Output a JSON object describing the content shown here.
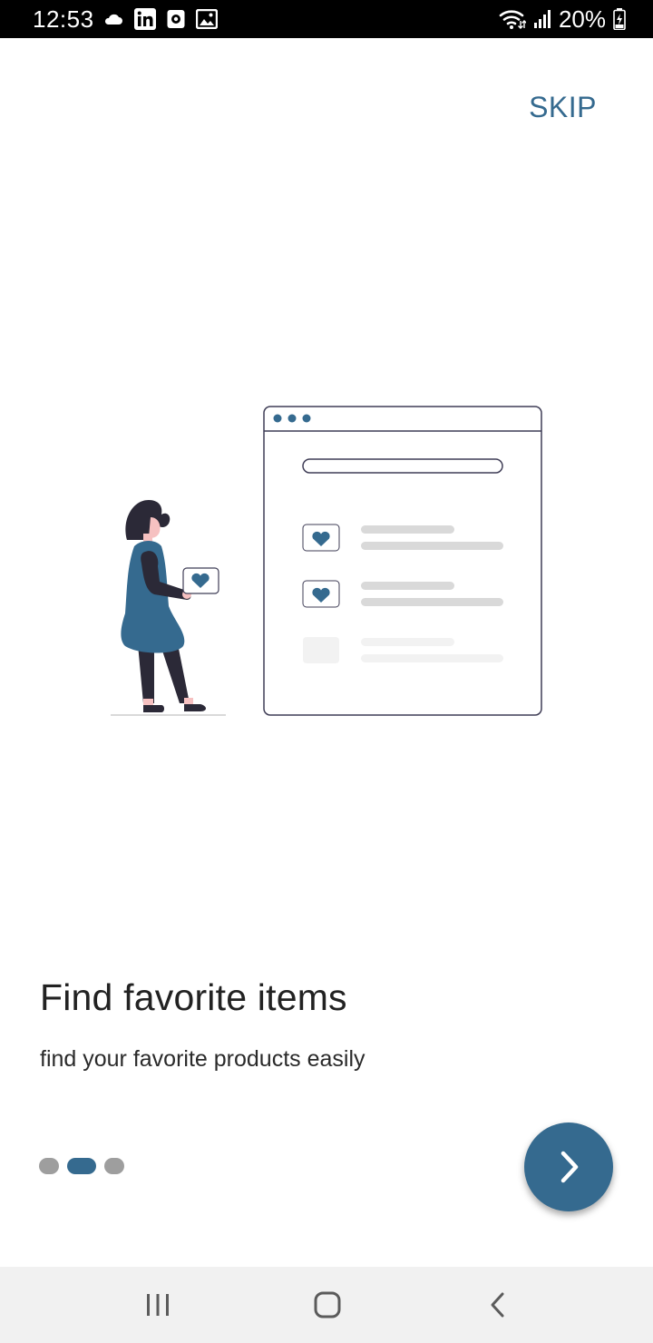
{
  "status_bar": {
    "time": "12:53",
    "battery": "20%",
    "left_icons": [
      "cloud-icon",
      "linkedin-icon",
      "screen-recorder-icon",
      "gallery-icon"
    ],
    "right_icons": [
      "wifi-icon",
      "signal-icon",
      "battery-charging-icon"
    ]
  },
  "skip_label": "SKIP",
  "slide": {
    "title": "Find favorite items",
    "subtitle": "find your favorite products easily"
  },
  "pager": {
    "total": 3,
    "active_index": 1
  },
  "next_icon": "chevron-right-icon",
  "nav_bar": {
    "recents_icon": "recents-icon",
    "home_icon": "home-icon",
    "back_icon": "back-icon"
  },
  "colors": {
    "accent": "#356a8f",
    "dot_inactive": "#9e9e9e",
    "illustration_dark": "#2b2937",
    "placeholder_gray": "#d9d9d9"
  }
}
